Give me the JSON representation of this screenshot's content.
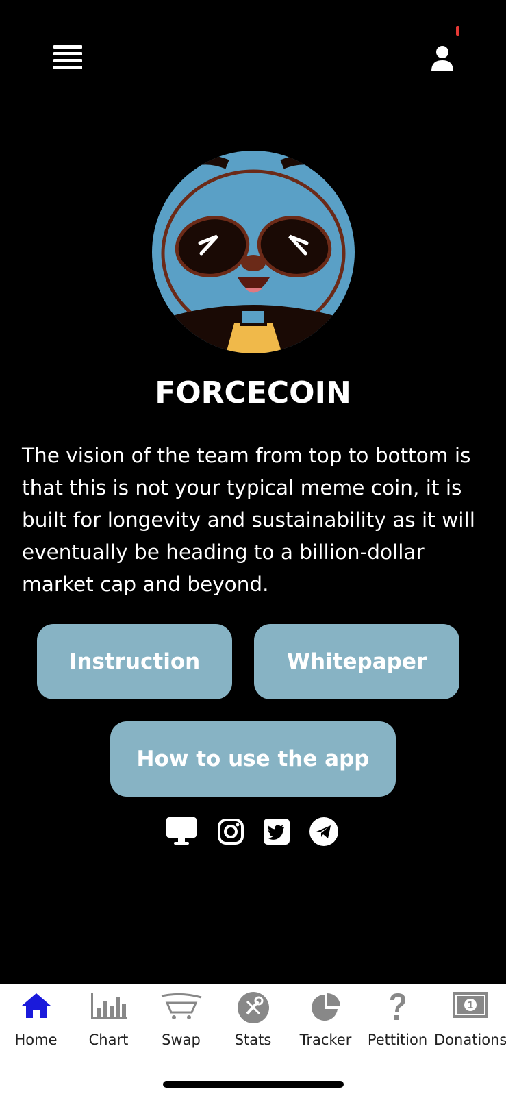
{
  "header": {
    "menu_icon": "hamburger-menu-icon",
    "profile_icon": "user-icon",
    "notification_color": "#e53935"
  },
  "hero": {
    "logo": "panda-mascot-logo",
    "title": "FORCECOIN",
    "description": "The vision of the team from top to bottom is that this is not your typical meme coin, it is built for longevity and sustainability as it will eventually be heading to a billion-dollar market cap and beyond."
  },
  "actions": {
    "instruction": "Instruction",
    "whitepaper": "Whitepaper",
    "how_to_use": "How to use the app",
    "button_color": "#87b3c4"
  },
  "social": [
    {
      "icon": "desktop-icon"
    },
    {
      "icon": "instagram-icon"
    },
    {
      "icon": "twitter-icon"
    },
    {
      "icon": "telegram-icon"
    }
  ],
  "nav": {
    "active_color": "#1a1adb",
    "inactive_color": "#888888",
    "items": [
      {
        "label": "Home",
        "icon": "home-icon",
        "active": true
      },
      {
        "label": "Chart",
        "icon": "bar-chart-icon",
        "active": false
      },
      {
        "label": "Swap",
        "icon": "swap-cart-icon",
        "active": false
      },
      {
        "label": "Stats",
        "icon": "stats-tools-icon",
        "active": false
      },
      {
        "label": "Tracker",
        "icon": "pie-chart-icon",
        "active": false
      },
      {
        "label": "Pettition",
        "icon": "question-icon",
        "active": false
      },
      {
        "label": "Donations",
        "icon": "money-bill-icon",
        "active": false
      }
    ]
  }
}
